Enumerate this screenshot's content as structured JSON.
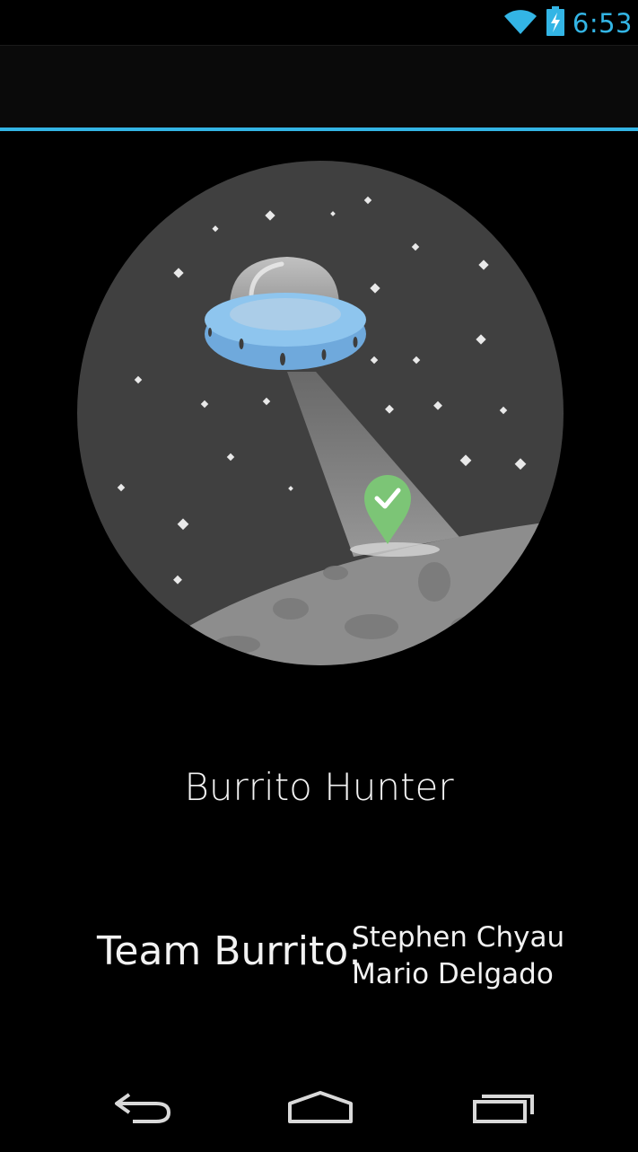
{
  "status_bar": {
    "time": "6:53",
    "wifi_icon": "wifi-icon",
    "battery_icon": "battery-charging-icon",
    "accent_color": "#33b5e5"
  },
  "action_bar": {
    "divider_color": "#33b5e5"
  },
  "illustration": {
    "icon": "ufo-illustration",
    "pin_icon": "map-pin-check-icon",
    "pin_color": "#7cc576",
    "saucer_color": "#8ec5ee"
  },
  "app": {
    "title": "Burrito Hunter"
  },
  "team": {
    "label": "Team Burrito:",
    "members": [
      "Stephen Chyau",
      "Mario Delgado"
    ]
  },
  "nav_bar": {
    "back_icon": "back-icon",
    "home_icon": "home-icon",
    "recents_icon": "recent-apps-icon"
  }
}
